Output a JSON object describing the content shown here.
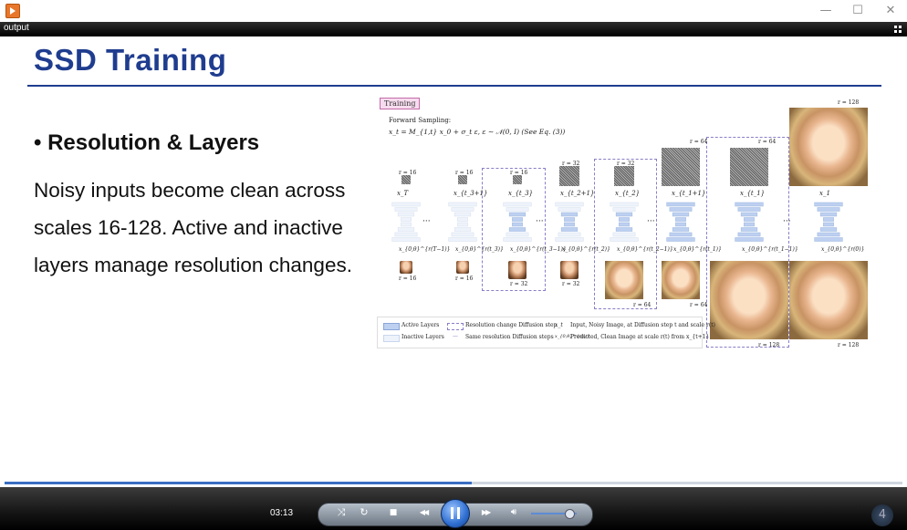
{
  "window": {
    "title": "",
    "min_glyph": "—",
    "max_glyph": "☐",
    "close_glyph": "✕",
    "app_icon": "media-player-icon"
  },
  "output_label": "output",
  "slide": {
    "title": "SSD Training",
    "bullet": "Resolution & Layers",
    "bullet_marker": "•",
    "body": "Noisy inputs become clean across scales 16-128. Active and inactive layers manage resolution changes."
  },
  "figure": {
    "tag": "Training",
    "forward_sampling": "Forward Sampling:",
    "equation": "x_t = M_{1,t} x_0 + σ_t ε,   ε ∼ 𝒩(0, I)   (See Eq. (3))",
    "top_labels": [
      "r = 16",
      "r = 16",
      "r = 16",
      "r = 32",
      "r = 32",
      "r = 64",
      "r = 64",
      "r = 128"
    ],
    "input_labels": [
      "x_T",
      "x_{t_3+1}",
      "x_{t_3}",
      "x_{t_2+1}",
      "x_{t_2}",
      "x_{t_1+1}",
      "x_{t_1}",
      "x_1"
    ],
    "output_labels": [
      "x_{0,θ}^{r(T−1)}",
      "x_{0,θ}^{r(t_3)}",
      "x_{0,θ}^{r(t_3−1)}",
      "x_{0,θ}^{r(t_2)}",
      "x_{0,θ}^{r(t_2−1)}",
      "x_{0,θ}^{r(t_1)}",
      "x_{0,θ}^{r(t_1−1)}",
      "x_{0,θ}^{r(0)}"
    ],
    "bottom_labels": [
      "r = 16",
      "r = 16",
      "r = 32",
      "r = 32",
      "r = 64",
      "r = 64",
      "r = 128",
      "r = 128"
    ],
    "ellipsis": "···",
    "legend": {
      "active": "Active Layers",
      "inactive": "Inactive Layers",
      "res_change": "Resolution change Diffusion step",
      "same_res": "Same resolution Diffusion steps",
      "xt_sym": "x_t",
      "xt_desc": "Input, Noisy Image, at Diffusion step t and scale r(t)",
      "x0_sym": "x_{0,θ}^{r(t)}",
      "x0_desc": "Predicted, Clean Image at scale r(t) from x_{t+1}"
    }
  },
  "player": {
    "time": "03:13",
    "progress": 0.52,
    "volume": 0.82,
    "corner_badge": "4",
    "icons": [
      "shuffle-icon",
      "repeat-icon",
      "stop-icon",
      "previous-icon",
      "pause-icon",
      "next-icon",
      "volume-icon",
      "switch-view-icon"
    ],
    "glyphs": {
      "shuffle": "⤨",
      "repeat": "↻",
      "stop": "■",
      "prev": "◀◀",
      "next": "▶▶",
      "volume": "🔊︎"
    }
  },
  "colors": {
    "title_blue": "#1f3d8f",
    "accent_blue": "#3a6fc2",
    "active_layer": "#bdd0f0",
    "inactive_layer": "#eef3fb"
  }
}
